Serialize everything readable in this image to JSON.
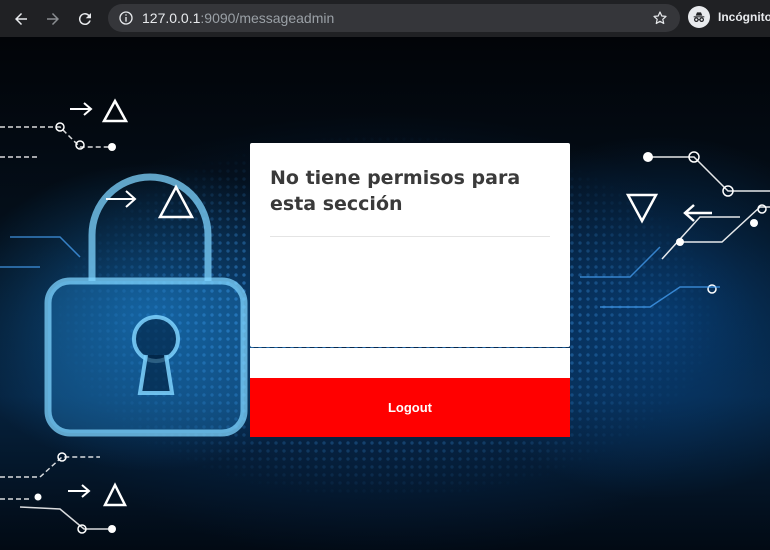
{
  "browser": {
    "url_host": "127.0.0.1",
    "url_path": ":9090/messageadmin",
    "profile_label": "Incógnito",
    "icons": [
      "back-arrow-icon",
      "forward-arrow-icon",
      "reload-icon",
      "info-icon",
      "star-icon",
      "incognito-icon"
    ]
  },
  "page": {
    "message": "No tiene permisos para esta sección",
    "logout_label": "Logout"
  },
  "colors": {
    "chrome_bg": "#202124",
    "logout_bg": "#ff0000",
    "card_bg": "#ffffff",
    "title_text": "#3a3a3a"
  }
}
